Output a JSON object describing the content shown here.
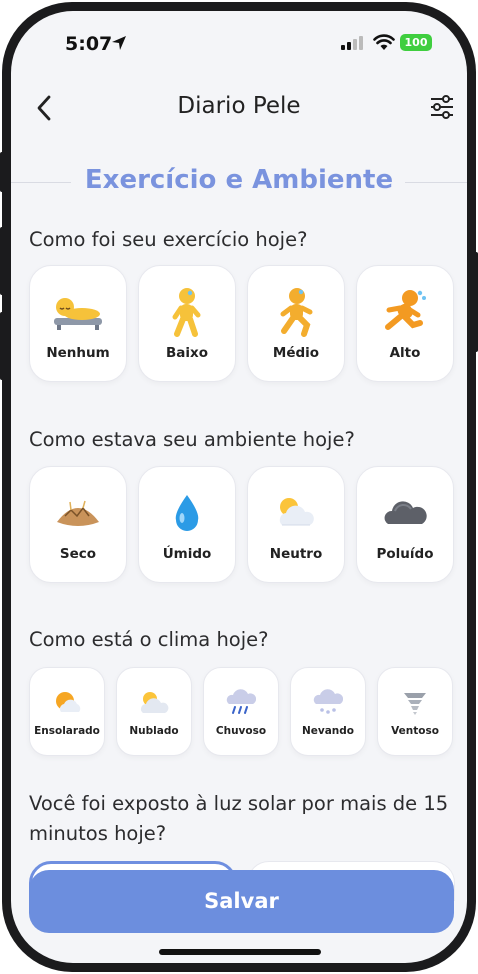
{
  "status_bar": {
    "time": "5:07",
    "battery": "100"
  },
  "nav": {
    "title": "Diario Pele"
  },
  "section": {
    "title": "Exercício e Ambiente"
  },
  "exercise": {
    "question": "Como foi seu exercício hoje?",
    "options": [
      {
        "label": "Nenhum",
        "icon": "person-in-bed-icon"
      },
      {
        "label": "Baixo",
        "icon": "person-walking-icon"
      },
      {
        "label": "Médio",
        "icon": "person-jogging-icon"
      },
      {
        "label": "Alto",
        "icon": "person-running-icon"
      }
    ]
  },
  "environment": {
    "question": "Como estava seu ambiente hoje?",
    "options": [
      {
        "label": "Seco",
        "icon": "dry-ground-icon"
      },
      {
        "label": "Úmido",
        "icon": "droplet-icon"
      },
      {
        "label": "Neutro",
        "icon": "sun-behind-cloud-icon"
      },
      {
        "label": "Poluído",
        "icon": "dark-cloud-icon"
      }
    ]
  },
  "weather": {
    "question": "Como está o clima hoje?",
    "options": [
      {
        "label": "Ensolarado",
        "icon": "sun-icon"
      },
      {
        "label": "Nublado",
        "icon": "cloudy-icon"
      },
      {
        "label": "Chuvoso",
        "icon": "rain-cloud-icon"
      },
      {
        "label": "Nevando",
        "icon": "snow-cloud-icon"
      },
      {
        "label": "Ventoso",
        "icon": "tornado-icon"
      }
    ]
  },
  "sun_exposure": {
    "question": "Você foi exposto à luz solar por mais de 15 minutos hoje?"
  },
  "actions": {
    "save_label": "Salvar"
  },
  "colors": {
    "accent": "#6c8ede",
    "section_title": "#7a93de",
    "background": "#f4f5f8"
  }
}
